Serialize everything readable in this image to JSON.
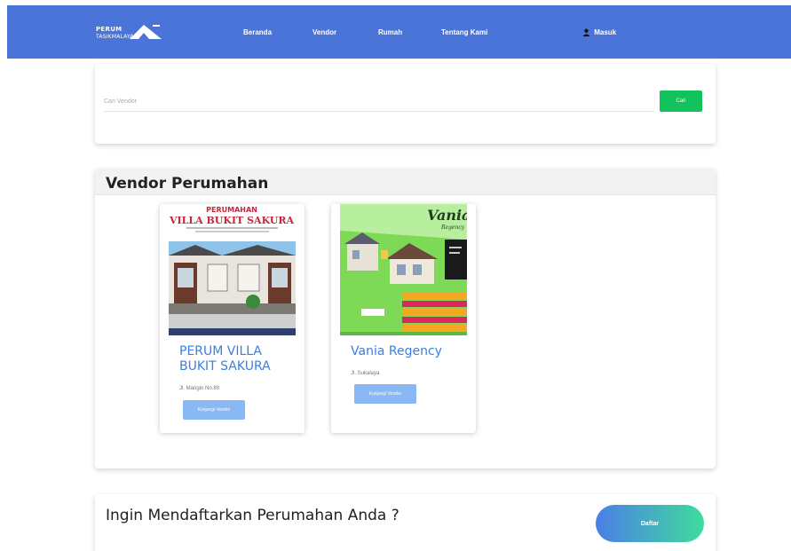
{
  "brand": {
    "line1": "PERUM",
    "line2": "TASIKMALAYA"
  },
  "nav": {
    "items": [
      {
        "label": "Beranda"
      },
      {
        "label": "Vendor"
      },
      {
        "label": "Rumah"
      },
      {
        "label": "Tentang Kami"
      }
    ],
    "login_label": "Masuk",
    "login_icon": "user-icon"
  },
  "search": {
    "placeholder": "Cari Vendor",
    "button_label": "Cari"
  },
  "vendor_section": {
    "title": "Vendor Perumahan",
    "vendors": [
      {
        "name": "PERUM VILLA BUKIT SAKURA",
        "address": "Jl. Mangin No.89",
        "button_label": "Kunjungi Vendor",
        "image_lines": [
          "PERUMAHAN",
          "VILLA BUKIT SAKURA"
        ]
      },
      {
        "name": "Vania Regency",
        "address": "Jl. Sukalaya",
        "button_label": "Kunjungi Vendor",
        "image_lines": [
          "Vania",
          "Regency"
        ]
      }
    ]
  },
  "register": {
    "text": "Ingin Mendaftarkan Perumahan Anda ?",
    "button_label": "Daftar"
  },
  "colors": {
    "navbar": "#4b74d8",
    "search_button": "#12c25a",
    "vendor_link": "#3b7fe4",
    "vendor_button": "#8ab8f5",
    "register_gradient_start": "#4a7fe6",
    "register_gradient_end": "#3fdc9c"
  }
}
